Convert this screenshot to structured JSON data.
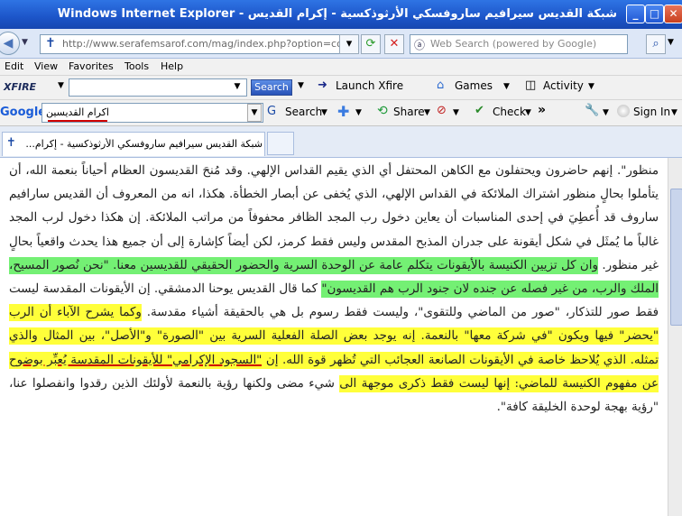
{
  "window": {
    "title": "شبكة القديس سيرافيم ساروفسكي الأرثوذكسية - إكرام القديس - Windows Internet Explorer",
    "buttons": {
      "minimize": "_",
      "maximize": "□",
      "close": "✕"
    }
  },
  "nav": {
    "address": "http://www.serafemsarof.com/mag/index.php?option=com_content",
    "search_placeholder": "Web Search (powered by Google)"
  },
  "menu": [
    "Edit",
    "View",
    "Favorites",
    "Tools",
    "Help"
  ],
  "xfire": {
    "logo": "XFIRE",
    "search_button": "Search",
    "launch": "Launch Xfire",
    "games": "Games",
    "activity": "Activity"
  },
  "google": {
    "logo": "Google",
    "query": "اكرام القديسين",
    "search": "Search",
    "share": "Share",
    "check": "Check",
    "signin": "Sign In"
  },
  "tab": {
    "label": "شبكة القديس سيرافيم ساروفسكي الأرثوذكسية - إكرام..."
  },
  "article": {
    "p_plain1": "منظور\". إنهم حاضرون ويحتفلون مع الكاهن المحتفل أي الذي يقيم القداس الإلهي. وقد مُنحَ القديسون العظام أحياناً بنعمة الله، أن يتأملوا بحالٍ منظور اشتراك الملائكة في القداس الإلهي، الذي يُخفى عن أبصار الخطأة. هكذا، انه من المعروف أن القديس سارافيم ساروف قد أُعطِيَ في إحدى المناسبات أن يعاين دخول رب المجد الظافر محفوفاً من مراتب الملائكة. إن هكذا دخول لرب المجد غالباً ما يُمثَل في شكل أيقونة على جدران المذبح المقدس وليس فقط كرمز، لكن أيضاً كإشارة إلى أن جميع هذا يحدث واقعياً بحالٍ غير منظور. ",
    "p_green": "وان كل تزيين الكنيسة بالأيقونات يتكلم عامة عن الوحدة السرية والحضور الحقيقي للقديسين معنا. \"نحن نُصور المسيح، الملك والرب، من غير فصله عن جنده لان جنود الرب هم القديسون\"",
    "p_plain2": " كما قال القديس يوحنا الدمشقي. إن الأيقونات المقدسة ليست فقط صور للتذكار، \"صور من الماضي وللتقوى\"، وليست فقط رسوم بل هي بالحقيقة أشياء مقدسة. ",
    "p_yellow1": "وكما يشرح الآباء أن الرب \"يحضر\" فيها ويكون \"في شركة معها\" بالنعمة. إنه يوجد بعض الصلة الفعلية السرية بين \"الصورة\" و\"الأصل\"، بين المثال والذي تمثله. الذي يُلاحظ خاصة في الأيقونات الصانعة العجائب التي تُظهر قوة الله. إن ",
    "p_yellow_ul": "\"السجود الإكرامي\" للأيقونات المقدسة يُعبِّر بوضوح",
    "p_yellow2": " عن مفهوم الكنيسة للماضي: إنها ليست فقط ذكرى موجهة الى",
    "p_plain3": " شيء مضى ولكنها رؤية بالنعمة لأولئك الذين رقدوا وانفصلوا عنا، \"رؤية بهجة لوحدة الخليقة كافة\"."
  }
}
